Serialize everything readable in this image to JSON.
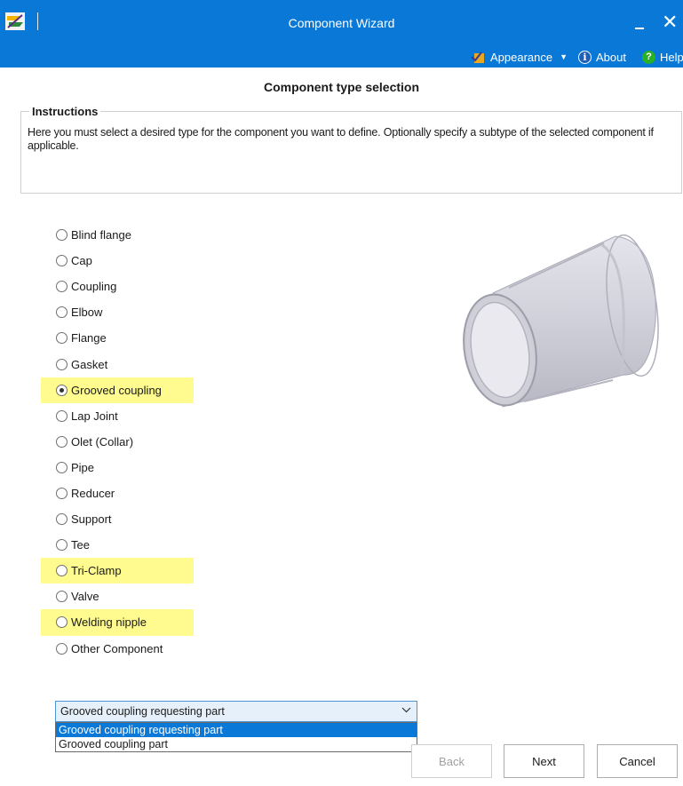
{
  "window": {
    "title": "Component Wizard",
    "close_glyph": "✕",
    "accent": "#0a78d7"
  },
  "ribbon": {
    "appearance_label": "Appearance",
    "about_label": "About",
    "help_label": "Help"
  },
  "page": {
    "heading": "Component type selection"
  },
  "instructions": {
    "title": "Instructions",
    "text": "Here you must select a desired type for the component you want to define. Optionally specify a subtype of the selected component if applicable."
  },
  "component_types": [
    {
      "label": "Blind flange",
      "checked": false,
      "highlighted": false
    },
    {
      "label": "Cap",
      "checked": false,
      "highlighted": false
    },
    {
      "label": "Coupling",
      "checked": false,
      "highlighted": false
    },
    {
      "label": "Elbow",
      "checked": false,
      "highlighted": false
    },
    {
      "label": "Flange",
      "checked": false,
      "highlighted": false
    },
    {
      "label": "Gasket",
      "checked": false,
      "highlighted": false
    },
    {
      "label": "Grooved coupling",
      "checked": true,
      "highlighted": true
    },
    {
      "label": "Lap Joint",
      "checked": false,
      "highlighted": false
    },
    {
      "label": "Olet (Collar)",
      "checked": false,
      "highlighted": false
    },
    {
      "label": "Pipe",
      "checked": false,
      "highlighted": false
    },
    {
      "label": "Reducer",
      "checked": false,
      "highlighted": false
    },
    {
      "label": "Support",
      "checked": false,
      "highlighted": false
    },
    {
      "label": "Tee",
      "checked": false,
      "highlighted": false
    },
    {
      "label": "Tri-Clamp",
      "checked": false,
      "highlighted": true
    },
    {
      "label": "Valve",
      "checked": false,
      "highlighted": false
    },
    {
      "label": "Welding nipple",
      "checked": false,
      "highlighted": true
    },
    {
      "label": "Other Component",
      "checked": false,
      "highlighted": false
    }
  ],
  "subtype": {
    "selected": "Grooved coupling requesting part",
    "options": [
      "Grooved coupling requesting part",
      "Grooved coupling part"
    ]
  },
  "buttons": {
    "back": "Back",
    "next": "Next",
    "cancel": "Cancel"
  },
  "colors": {
    "highlight": "#fffb8e",
    "titlebar": "#0a78d7"
  }
}
